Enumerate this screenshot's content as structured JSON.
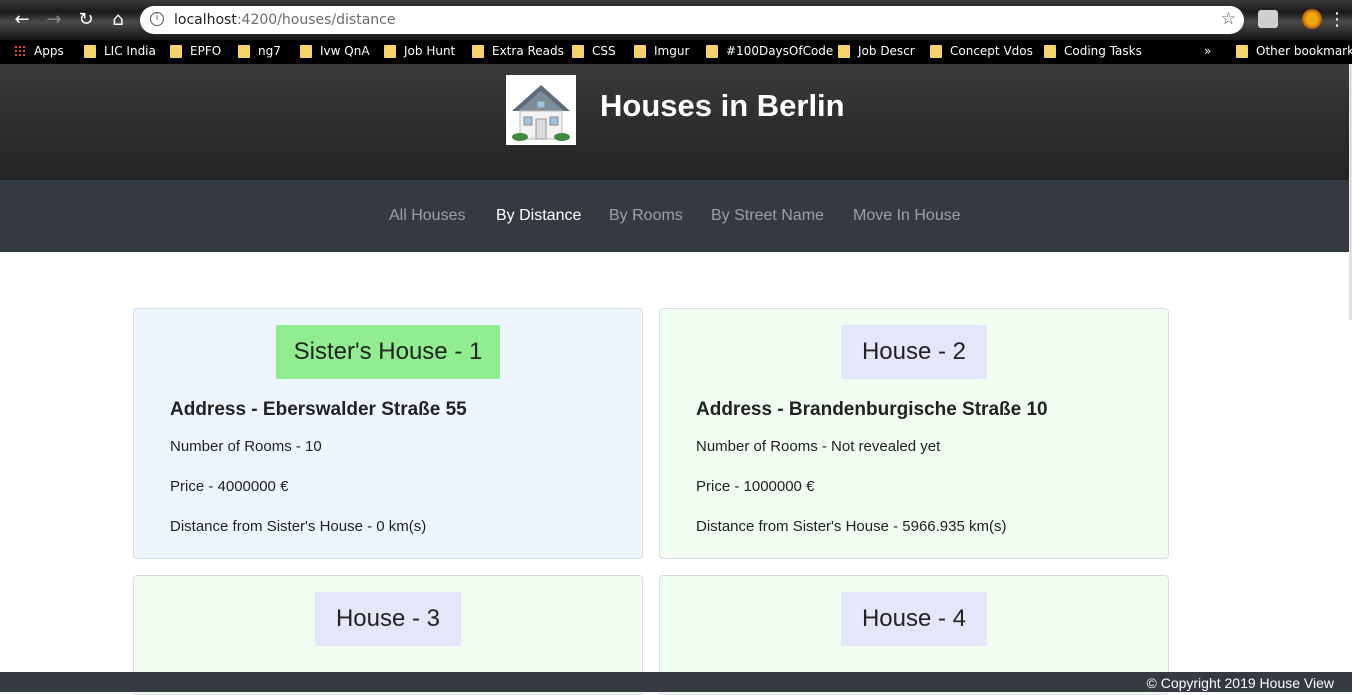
{
  "browser": {
    "url_host": "localhost",
    "url_path": ":4200/houses/distance",
    "bookmarks": [
      "Apps",
      "LIC India",
      "EPFO",
      "ng7",
      "Ivw QnA",
      "Job Hunt",
      "Extra Reads",
      "CSS",
      "Imgur",
      "#100DaysOfCode",
      "Job Descr",
      "Concept Vdos",
      "Coding Tasks"
    ],
    "overflow": "»",
    "other_bookmarks": "Other bookmarks"
  },
  "header": {
    "title": "Houses in Berlin"
  },
  "nav": {
    "items": [
      "All Houses",
      "By Distance",
      "By Rooms",
      "By Street Name",
      "Move In House"
    ],
    "active": "By Distance"
  },
  "cards": [
    {
      "name": "Sister's House - 1",
      "address": "Address - Eberswalder Straße 55",
      "rooms": "Number of Rooms - 10",
      "price": "Price - 4000000 €",
      "distance": "Distance from Sister's House - 0 km(s)"
    },
    {
      "name": "House - 2",
      "address": "Address - Brandenburgische Straße 10",
      "rooms": "Number of Rooms - Not revealed yet",
      "price": "Price - 1000000 €",
      "distance": "Distance from Sister's House - 5966.935 km(s)"
    },
    {
      "name": "House - 3"
    },
    {
      "name": "House - 4"
    }
  ],
  "footer": {
    "copyright": "© Copyright 2019 House View"
  },
  "colors": {
    "sister_badge": "#90ee90",
    "house_badge": "#e6e6fa",
    "sister_card": "#eef6fd",
    "house_card": "#f0fdf0",
    "nav_bg": "#343a40"
  }
}
